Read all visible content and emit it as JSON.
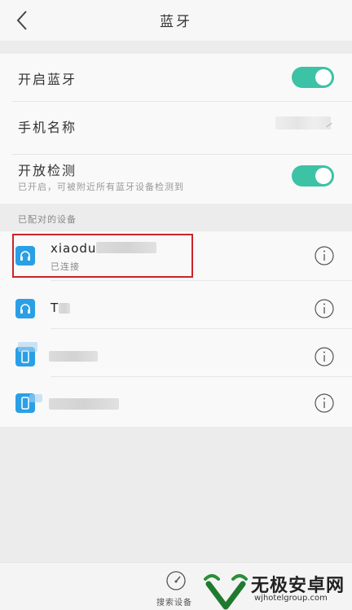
{
  "header": {
    "title": "蓝牙",
    "back_icon": "back-chevron-icon"
  },
  "settings": {
    "bluetooth_label": "开启蓝牙",
    "bluetooth_on": true,
    "phone_name_label": "手机名称",
    "discoverable_label": "开放检测",
    "discoverable_sub": "已开启，可被附近所有蓝牙设备检测到",
    "discoverable_on": true
  },
  "paired": {
    "section_title": "已配对的设备",
    "devices": [
      {
        "name": "xiaodu",
        "status": "已连接",
        "icon": "headphones-icon"
      },
      {
        "name": "T",
        "status": "",
        "icon": "headphones-icon"
      },
      {
        "name": "",
        "status": "",
        "icon": "phone-icon"
      },
      {
        "name": "",
        "status": "",
        "icon": "phone-icon"
      }
    ]
  },
  "bottom": {
    "scan_label": "搜索设备"
  },
  "watermark": {
    "brand": "无极安卓网",
    "url": "wjhotelgroup.com"
  },
  "colors": {
    "accent": "#3cc2a4",
    "icon_blue": "#2b9fe5",
    "highlight_red": "#c9252c"
  }
}
